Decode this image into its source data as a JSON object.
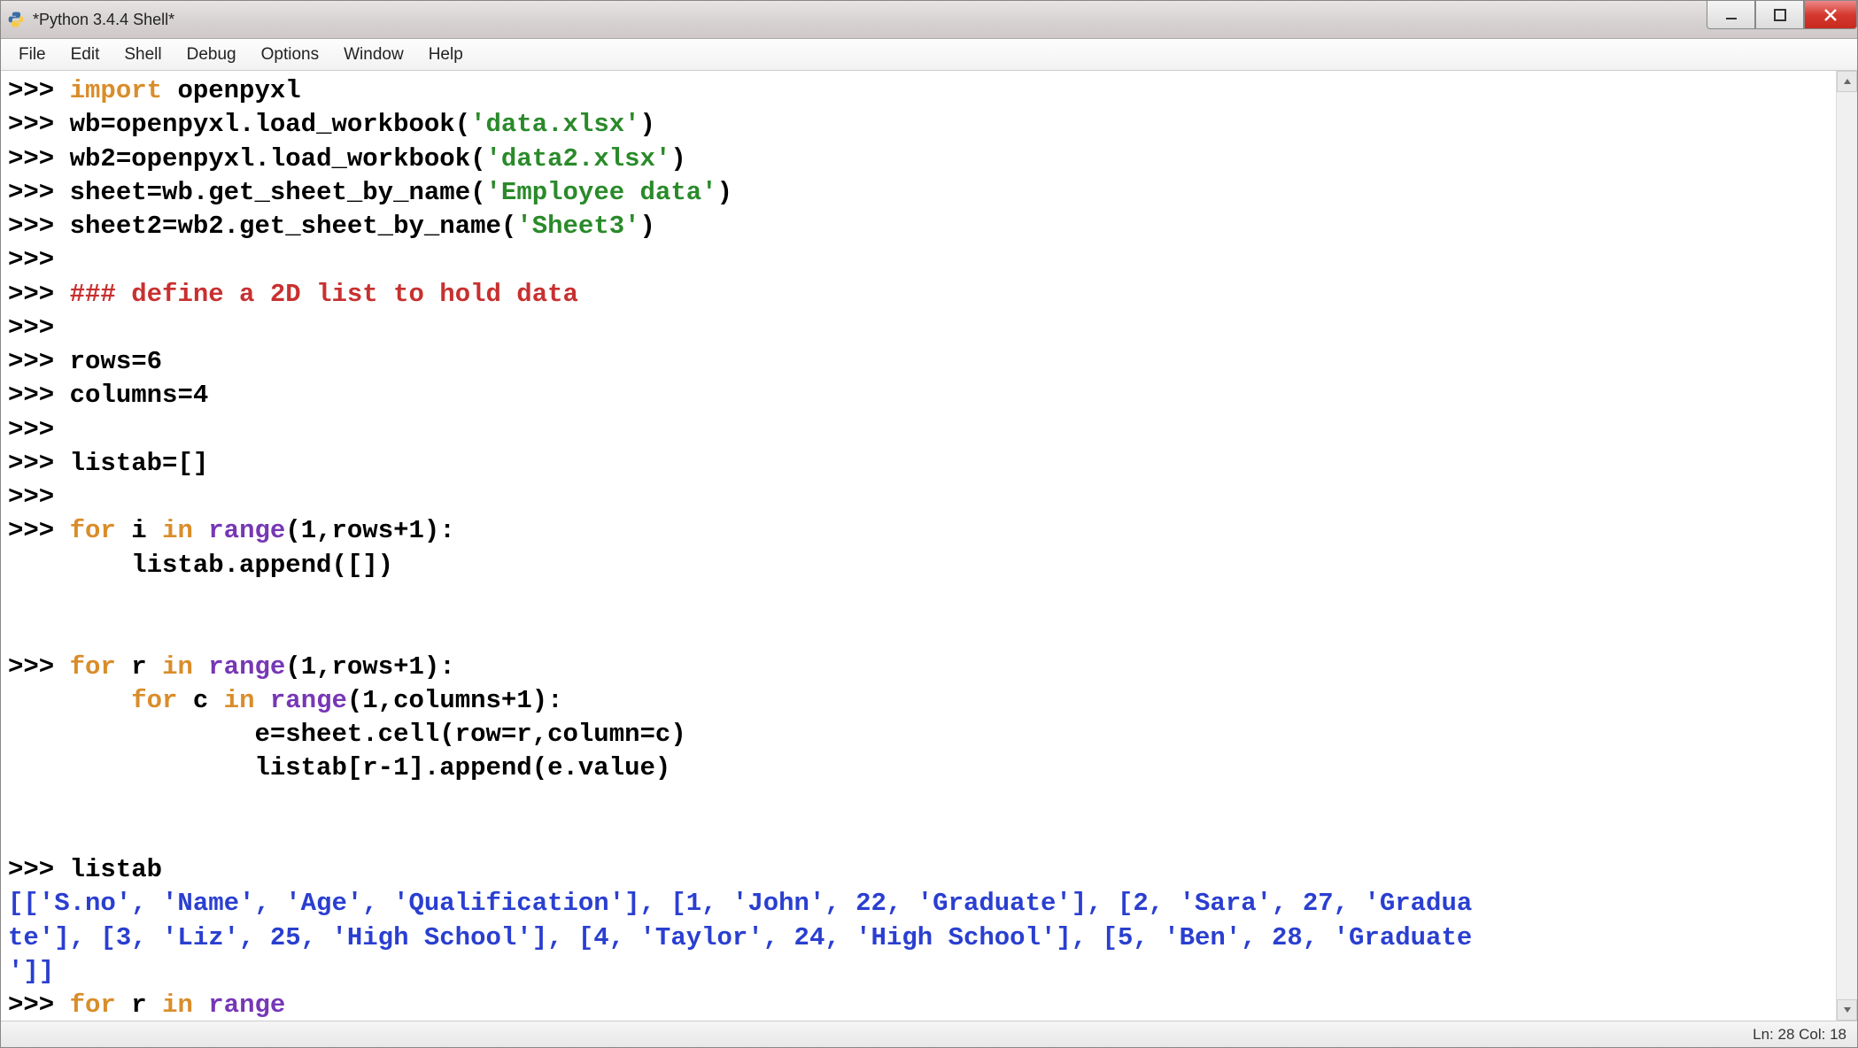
{
  "window": {
    "title": "*Python 3.4.4 Shell*"
  },
  "menu": {
    "file": "File",
    "edit": "Edit",
    "shell": "Shell",
    "debug": "Debug",
    "options": "Options",
    "window": "Window",
    "help": "Help"
  },
  "code": {
    "prompt": ">>> ",
    "cont": "",
    "l1_kw": "import",
    "l1_rest": " openpyxl",
    "l2_a": "wb=openpyxl.load_workbook(",
    "l2_s": "'data.xlsx'",
    "l2_b": ")",
    "l3_a": "wb2=openpyxl.load_workbook(",
    "l3_s": "'data2.xlsx'",
    "l3_b": ")",
    "l4_a": "sheet=wb.get_sheet_by_name(",
    "l4_s": "'Employee data'",
    "l4_b": ")",
    "l5_a": "sheet2=wb2.get_sheet_by_name(",
    "l5_s": "'Sheet3'",
    "l5_b": ")",
    "l7_cmt": "### define a 2D list to hold data",
    "l9": "rows=6",
    "l10": "columns=4",
    "l12": "listab=[]",
    "l14_for": "for",
    "l14_mid1": " i ",
    "l14_in": "in",
    "l14_sp": " ",
    "l14_range": "range",
    "l14_tail": "(1,rows+1):",
    "l15": "        listab.append([])",
    "l17_for": "for",
    "l17_mid1": " r ",
    "l17_in": "in",
    "l17_sp": " ",
    "l17_range": "range",
    "l17_tail": "(1,rows+1):",
    "l18_pad": "        ",
    "l18_for": "for",
    "l18_mid1": " c ",
    "l18_in": "in",
    "l18_sp": " ",
    "l18_range": "range",
    "l18_tail": "(1,columns+1):",
    "l19": "                e=sheet.cell(row=r,column=c)",
    "l20": "                listab[r-1].append(e.value)",
    "l22": "listab",
    "out1": "[['S.no', 'Name', 'Age', 'Qualification'], [1, 'John', 22, 'Graduate'], [2, 'Sara', 27, 'Gradua",
    "out2": "te'], [3, 'Liz', 25, 'High School'], [4, 'Taylor', 24, 'High School'], [5, 'Ben', 28, 'Graduate",
    "out3": "']]",
    "l24_for": "for",
    "l24_mid1": " r ",
    "l24_in": "in",
    "l24_sp": " ",
    "l24_range": "range"
  },
  "status": {
    "text": "Ln: 28  Col: 18"
  }
}
